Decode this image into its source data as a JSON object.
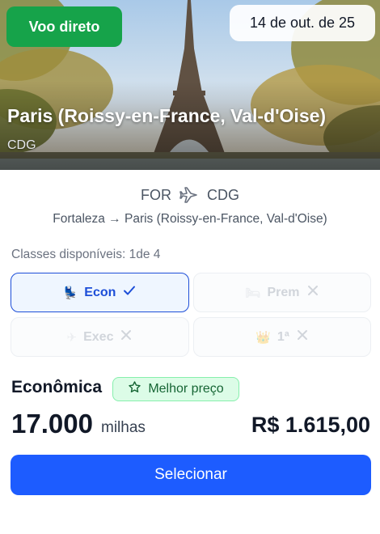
{
  "hero": {
    "badge_direct": "Voo direto",
    "date": "14 de out. de 25",
    "destination": "Paris (Roissy-en-France, Val-d'Oise)",
    "code": "CDG",
    "image": "eiffel-tower-photo"
  },
  "route": {
    "from": "FOR",
    "to": "CDG",
    "icon": "airplane-icon",
    "full": "Fortaleza → Paris (Roissy-en-France, Val-d'Oise)"
  },
  "classes": {
    "label": "Classes disponíveis: 1de 4",
    "items": [
      {
        "emoji": "💺",
        "label": "Econ",
        "state": "selected",
        "status_icon": "check-icon"
      },
      {
        "emoji": "🛏",
        "label": "Prem",
        "state": "unavailable",
        "status_icon": "x-icon"
      },
      {
        "emoji": "✈",
        "label": "Exec",
        "state": "unavailable",
        "status_icon": "x-icon"
      },
      {
        "emoji": "👑",
        "label": "1ª",
        "state": "unavailable",
        "status_icon": "x-icon"
      }
    ]
  },
  "offer": {
    "class_name": "Econômica",
    "best_price_label": "Melhor preço",
    "miles": "17.000",
    "miles_unit": "milhas",
    "price": "R$ 1.615,00"
  },
  "actions": {
    "select_label": "Selecionar"
  },
  "colors": {
    "accent": "#1d5cff",
    "active_border": "#1d4ed8",
    "success": "#16a34a",
    "best_price_bg": "#dcfce7"
  }
}
